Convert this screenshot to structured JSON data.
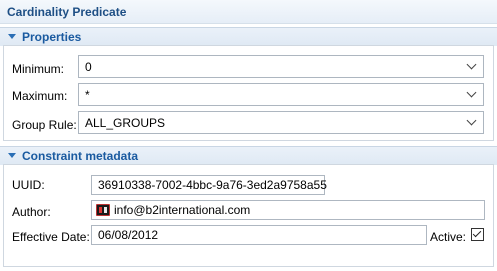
{
  "title": "Cardinality Predicate",
  "sections": {
    "properties": {
      "header": "Properties",
      "minimum": {
        "label": "Minimum:",
        "value": "0"
      },
      "maximum": {
        "label": "Maximum:",
        "value": "*"
      },
      "group_rule": {
        "label": "Group Rule:",
        "value": "ALL_GROUPS"
      }
    },
    "metadata": {
      "header": "Constraint metadata",
      "uuid": {
        "label": "UUID:",
        "value": "36910338-7002-4bbc-9a76-3ed2a9758a55"
      },
      "author": {
        "label": "Author:",
        "value": "info@b2international.com",
        "icon": "author-logo-icon"
      },
      "effective_date": {
        "label": "Effective Date:",
        "value": "06/08/2012"
      },
      "active": {
        "label": "Active:",
        "checked": true
      }
    }
  },
  "colors": {
    "header_text": "#1a5aa0",
    "title_text": "#1e4f85",
    "twisty": "#2a6eb5"
  }
}
